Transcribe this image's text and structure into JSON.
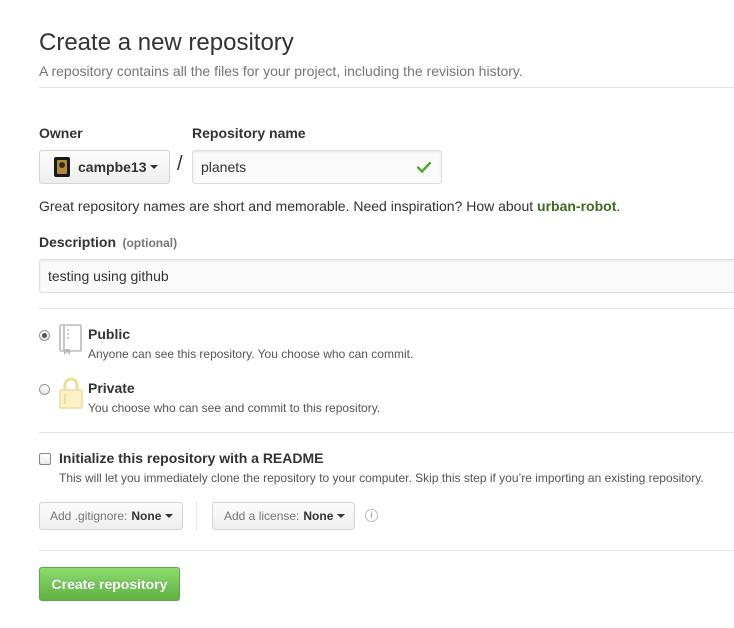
{
  "header": {
    "title": "Create a new repository",
    "subtitle": "A repository contains all the files for your project, including the revision history."
  },
  "owner": {
    "label": "Owner",
    "value": "campbe13",
    "separator": "/"
  },
  "repo_name": {
    "label": "Repository name",
    "value": "planets",
    "valid": true
  },
  "suggestion": {
    "prefix": "Great repository names are short and memorable. Need inspiration? How about ",
    "name": "urban-robot",
    "suffix": "."
  },
  "description": {
    "label": "Description",
    "optional": "(optional)",
    "value": "testing using github"
  },
  "visibility": {
    "selected": "public",
    "public": {
      "title": "Public",
      "note": "Anyone can see this repository. You choose who can commit."
    },
    "private": {
      "title": "Private",
      "note": "You choose who can see and commit to this repository."
    }
  },
  "readme": {
    "checked": false,
    "title": "Initialize this repository with a README",
    "note": "This will let you immediately clone the repository to your computer. Skip this step if you’re importing an existing repository."
  },
  "gitignore": {
    "prefix": "Add .gitignore:",
    "value": "None"
  },
  "license": {
    "prefix": "Add a license:",
    "value": "None"
  },
  "submit": {
    "label": "Create repository"
  },
  "colors": {
    "accent_green": "#60b044",
    "link_green": "#3d6b1f",
    "check_green": "#55a532",
    "muted": "#767676"
  },
  "icons": {
    "owner_avatar": "avatar",
    "valid": "check-icon",
    "public": "repo-book-icon",
    "private": "lock-icon",
    "help": "info-icon"
  }
}
